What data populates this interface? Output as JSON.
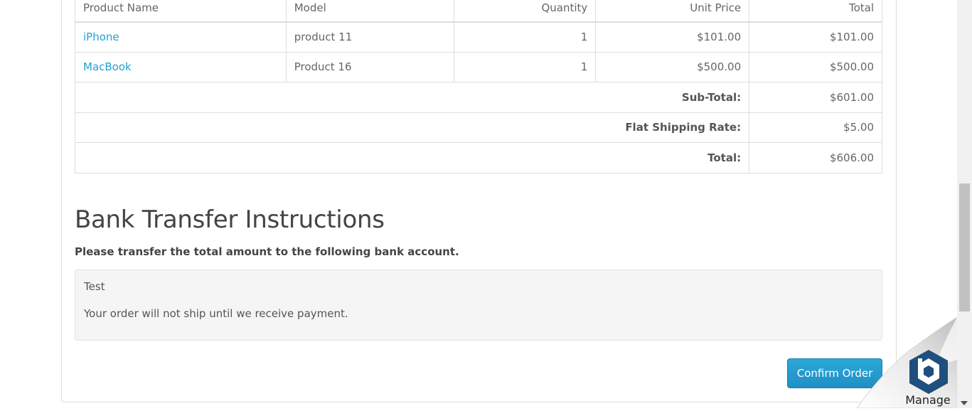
{
  "cart": {
    "headers": {
      "product_name": "Product Name",
      "model": "Model",
      "quantity": "Quantity",
      "unit_price": "Unit Price",
      "total": "Total"
    },
    "rows": [
      {
        "name": "iPhone",
        "model": "product 11",
        "quantity": "1",
        "unit_price": "$101.00",
        "total": "$101.00"
      },
      {
        "name": "MacBook",
        "model": "Product 16",
        "quantity": "1",
        "unit_price": "$500.00",
        "total": "$500.00"
      }
    ],
    "totals": [
      {
        "label": "Sub-Total:",
        "value": "$601.00"
      },
      {
        "label": "Flat Shipping Rate:",
        "value": "$5.00"
      },
      {
        "label": "Total:",
        "value": "$606.00"
      }
    ]
  },
  "bank_transfer": {
    "title": "Bank Transfer Instructions",
    "lead": "Please transfer the total amount to the following bank account.",
    "account_text": "Test",
    "notice": "Your order will not ship until we receive payment."
  },
  "actions": {
    "confirm_label": "Confirm Order"
  },
  "widget": {
    "manage_label": "Manage",
    "icon": "hexagon-logo-icon"
  },
  "colors": {
    "link": "#23a1d1",
    "button": "#229ac8",
    "widget_hex": "#1e4f7d"
  }
}
